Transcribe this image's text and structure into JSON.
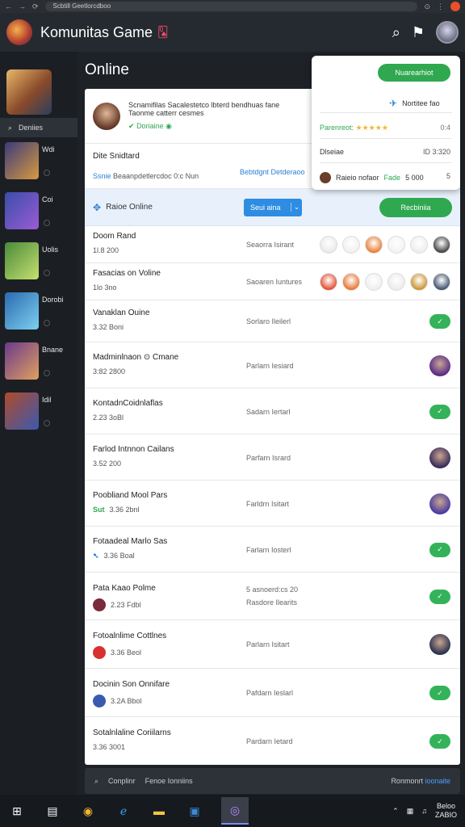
{
  "browser": {
    "url": "Scbtill Geetlorcdboo",
    "nav_back": "←",
    "nav_forward": "→"
  },
  "header": {
    "title": "Komunitas Game",
    "badge": "🂭"
  },
  "sidebar": {
    "search_label": "Deniies",
    "items": [
      {
        "label": "Wdi",
        "colors": [
          "#3b3a7a",
          "#d89a40"
        ]
      },
      {
        "label": "Coi",
        "colors": [
          "#3a4ea8",
          "#9b5bd6"
        ]
      },
      {
        "label": "Uolis",
        "colors": [
          "#4a8a3a",
          "#c6e070"
        ]
      },
      {
        "label": "Dorobi",
        "colors": [
          "#2a6ab0",
          "#7dd0f0"
        ]
      },
      {
        "label": "Bnane",
        "colors": [
          "#6b3a8a",
          "#e0a060"
        ]
      },
      {
        "label": "Idil",
        "colors": [
          "#b04a2a",
          "#3a5ab0"
        ]
      }
    ]
  },
  "page_title": "Online",
  "profile": {
    "name_line": "Scnamifilas",
    "desc1": "Sacalestetco lbterd bendhuas fane",
    "desc2": "Taonme catterr cesmes",
    "status": "Doriaine"
  },
  "stats": {
    "title": "Dite Snidtard",
    "sub_left": "Ssnie",
    "sub_text": "Beaanpdetlercdoc 0:c Nun",
    "right": "Bebtdgnt Detderaoo"
  },
  "filter": {
    "label": "Raioe Online",
    "dropdown": "Seui aina",
    "button": "Recbiniia"
  },
  "popover": {
    "button": "Nuarearhiot",
    "notif": "Nortitee fao",
    "rating_label": "Parenreot:",
    "rating_stars": "★★★★★",
    "rating_value": "0:4",
    "row2_label": "Dlseiae",
    "row2_value": "ID 3:320",
    "row3_label": "Raieio nofaor",
    "row3_highlight": "Fade",
    "row3_mid": "5 000",
    "row3_value": "5"
  },
  "rows": [
    {
      "name": "Doom Rand",
      "time": "1l.8 200",
      "status": "Seaorra Isirant",
      "type": "avatars",
      "avatars": [
        "#e8e8e8",
        "#efefef",
        "#e87a2a",
        "#f2f2f2",
        "#ececec",
        "#3a3a3a"
      ]
    },
    {
      "name": "Fasacias on Voline",
      "time": "1lo 3no",
      "status": "Saoaren Iuntures",
      "type": "avatars",
      "avatars": [
        "#e0482a",
        "#e8702a",
        "#eeeeee",
        "#eaeaea",
        "#c8902a",
        "#3a4a6a"
      ]
    },
    {
      "name": "Vanaklan Ouine",
      "time": "3.32 Boni",
      "status": "Sorlaro Ileilerl",
      "type": "action"
    },
    {
      "name": "Madminlnaon ⊙ Cmane",
      "time": "3:82 2800",
      "status": "Parlarn Iesiard",
      "type": "avatar",
      "avatar": "#5a2a8a"
    },
    {
      "name": "KontadnCoidnlaflas",
      "time": "2.23 3oBl",
      "status": "Sadarn Iertarl",
      "type": "action"
    },
    {
      "name": "Farlod Intnnon Cailans",
      "time": "3.52 200",
      "status": "Parfarn Isrard",
      "type": "avatar",
      "avatar": "#3a2a5a"
    },
    {
      "name": "Poobliand Mool Pars",
      "time": "3.36 2bnl",
      "time_prefix": "Sut",
      "status": "Farldrn Isitart",
      "type": "avatar",
      "avatar": "#4a3aa0"
    },
    {
      "name": "Fotaadeal Marlo Sas",
      "time": "3.36 Boal",
      "time_prefix": "➷",
      "status": "Farlarn Iosterl",
      "type": "action"
    },
    {
      "name": "Pata Kaao Polme",
      "time": "2.23 Fdbl",
      "status": "5 asnoerd:cs 20",
      "status2": "Rasdore Ilearits",
      "type": "action",
      "dot": "#7a2a3a"
    },
    {
      "name": "Fotoalnlime Cottlnes",
      "time": "3.36 Beol",
      "status": "Parlarn Isitart",
      "type": "avatar",
      "avatar": "#2a3050",
      "dot": "#d83030"
    },
    {
      "name": "Docinin Son Onnifare",
      "time": "3.2A Bbol",
      "status": "Pafdarn Ieslarl",
      "type": "action",
      "dot": "#3a5ab0"
    },
    {
      "name": "Sotalnlaline Coriilarns",
      "time": "3.36 3001",
      "status": "Pardarn Ietard",
      "type": "action"
    }
  ],
  "footer": {
    "search_label": "Conplinr",
    "search_hint": "Fenoe Ionniins",
    "right": "Ronmonrt",
    "right_link": "ioonaite"
  },
  "taskbar": {
    "clock_time": "Beloo",
    "clock_date": "ZABIO"
  },
  "colors": {
    "accent_green": "#2fa84f",
    "accent_blue": "#2e8de2",
    "bg_dark": "#1e2227"
  }
}
